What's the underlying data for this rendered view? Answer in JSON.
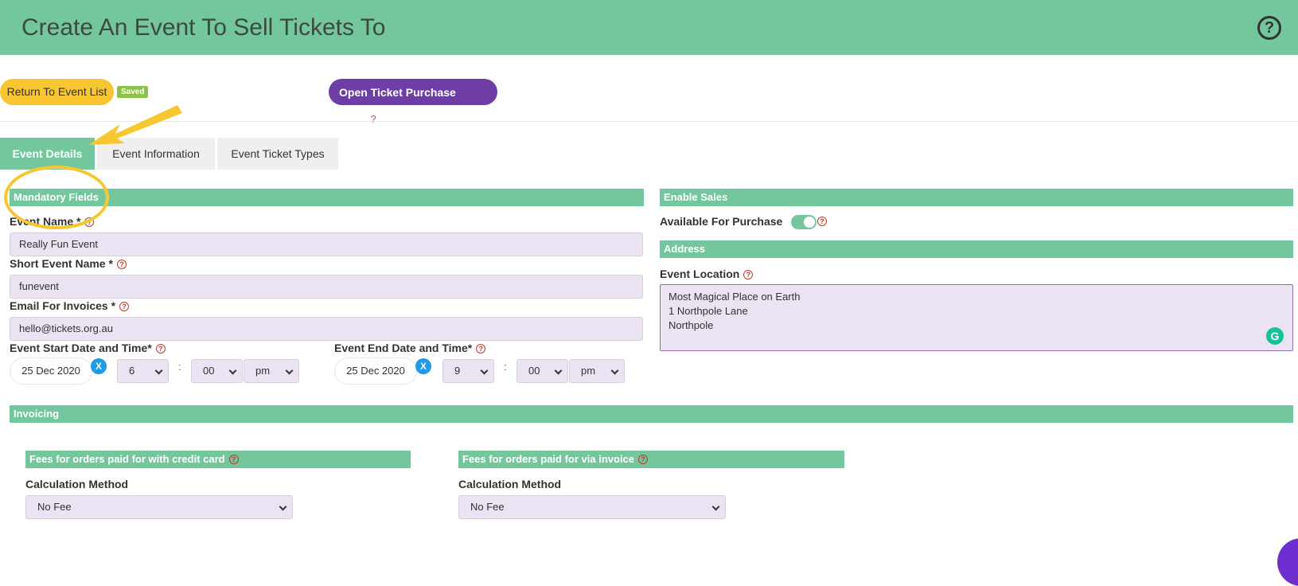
{
  "header": {
    "title": "Create An Event To Sell Tickets To",
    "help_icon": "?"
  },
  "toolbar": {
    "return_label": "Return To Event List",
    "saved_badge": "Saved",
    "purchase_label": "Open Ticket Purchase Page",
    "purchase_help": "?"
  },
  "tabs": [
    {
      "label": "Event Details",
      "active": true
    },
    {
      "label": "Event Information",
      "active": false
    },
    {
      "label": "Event Ticket Types",
      "active": false
    }
  ],
  "mandatory": {
    "section_title": "Mandatory Fields",
    "event_name_label": "Event Name *",
    "event_name_value": "Really Fun Event",
    "short_name_label": "Short Event Name *",
    "short_name_value": "funevent",
    "email_label": "Email For Invoices *",
    "email_value": "hello@tickets.org.au",
    "start_label": "Event Start Date and Time*",
    "start_date": "25 Dec 2020",
    "start_hour": "6",
    "start_minute": "00",
    "start_ampm": "pm",
    "end_label": "Event End Date and Time*",
    "end_date": "25 Dec 2020",
    "end_hour": "9",
    "end_minute": "00",
    "end_ampm": "pm",
    "clear_label": "X",
    "colon": ":"
  },
  "sales": {
    "section_title": "Enable Sales",
    "available_label": "Available For Purchase",
    "available_on": true
  },
  "address": {
    "section_title": "Address",
    "location_label": "Event Location",
    "location_lines": [
      "Most Magical Place on Earth",
      "1 Northpole Lane",
      "Northpole"
    ]
  },
  "invoicing": {
    "section_title": "Invoicing",
    "credit_title": "Fees for orders paid for with credit card",
    "credit_method_label": "Calculation Method",
    "credit_method_value": "No Fee",
    "invoice_title": "Fees for orders paid for via invoice",
    "invoice_method_label": "Calculation Method",
    "invoice_method_value": "No Fee"
  },
  "help_glyph": "?",
  "grammarly_glyph": "G",
  "colors": {
    "accent": "#74c69d",
    "purple": "#6f3ea5",
    "yellow": "#f8c630",
    "input_bg": "#ebe2f2"
  }
}
